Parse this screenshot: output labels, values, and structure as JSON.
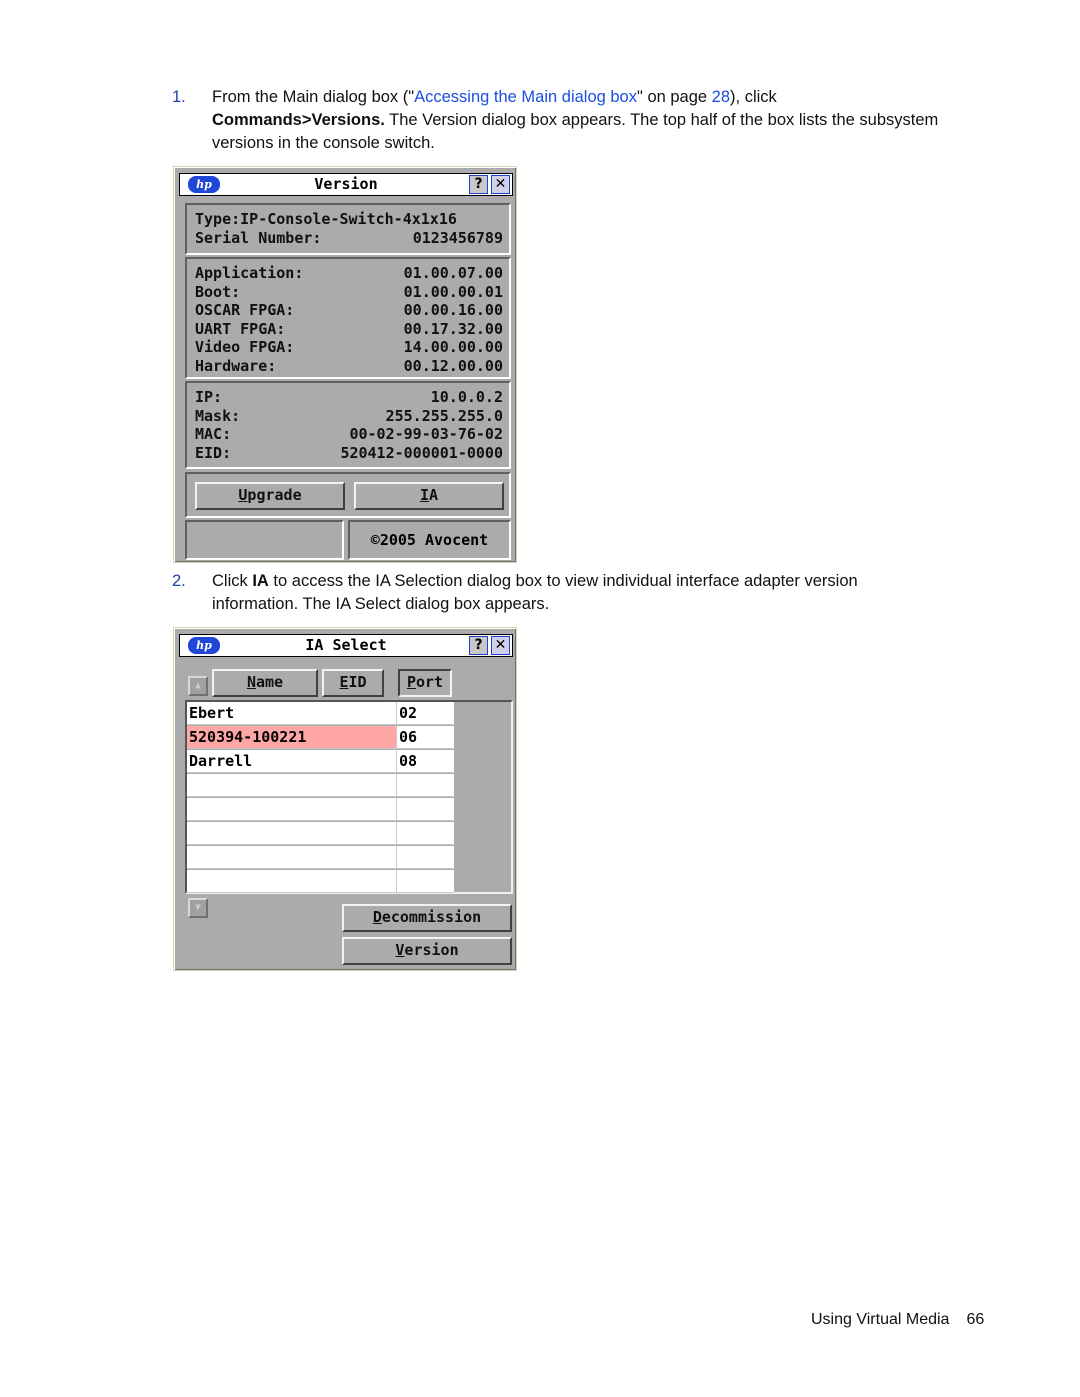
{
  "steps": [
    {
      "number": "1.",
      "text_before_link": "From the Main dialog box (\"",
      "link_text": "Accessing the Main dialog box",
      "text_mid": "\" on page ",
      "page_link": "28",
      "text_after": "), click",
      "bold": "Commands>Versions.",
      "text_rest": " The Version dialog box appears. The top half of the box lists the subsystem versions in the console switch."
    },
    {
      "number": "2.",
      "text_before_bold": "Click ",
      "bold": "IA",
      "text_rest": " to access the IA Selection dialog box to view individual interface adapter version information. The IA Select dialog box appears."
    }
  ],
  "version_dialog": {
    "logo": "hp",
    "title": "Version",
    "help_icon": "?",
    "close_icon": "✕",
    "identity": [
      {
        "label": "Type:IP-Console-Switch-4x1x16",
        "value": ""
      },
      {
        "label": "Serial Number:",
        "value": "0123456789"
      }
    ],
    "versions": [
      {
        "label": "Application:",
        "value": "01.00.07.00"
      },
      {
        "label": "Boot:",
        "value": "01.00.00.01"
      },
      {
        "label": "OSCAR FPGA:",
        "value": "00.00.16.00"
      },
      {
        "label": "UART FPGA:",
        "value": "00.17.32.00"
      },
      {
        "label": "Video FPGA:",
        "value": "14.00.00.00"
      },
      {
        "label": "Hardware:",
        "value": "00.12.00.00"
      }
    ],
    "network": [
      {
        "label": "IP:",
        "value": "10.0.0.2"
      },
      {
        "label": "Mask:",
        "value": "255.255.255.0"
      },
      {
        "label": "MAC:",
        "value": "00-02-99-03-76-02"
      },
      {
        "label": "EID:",
        "value": "520412-000001-0000"
      }
    ],
    "buttons": {
      "upgrade_hotkey": "U",
      "upgrade_rest": "pgrade",
      "ia_hotkey": "I",
      "ia_rest": "A"
    },
    "copyright": "©2005 Avocent"
  },
  "ia_select_dialog": {
    "logo": "hp",
    "title": "IA Select",
    "help_icon": "?",
    "close_icon": "✕",
    "sort_buttons": {
      "name_hotkey": "N",
      "name_rest": "ame",
      "eid_hotkey": "E",
      "eid_rest": "ID",
      "port_hotkey": "P",
      "port_rest": "ort"
    },
    "rows": [
      {
        "name": "Ebert",
        "port": "02",
        "selected": false
      },
      {
        "name": "520394-100221",
        "port": "06",
        "selected": true
      },
      {
        "name": "Darrell",
        "port": "08",
        "selected": false
      },
      {
        "name": "",
        "port": "",
        "selected": false
      },
      {
        "name": "",
        "port": "",
        "selected": false
      },
      {
        "name": "",
        "port": "",
        "selected": false
      },
      {
        "name": "",
        "port": "",
        "selected": false
      },
      {
        "name": "",
        "port": "",
        "selected": false
      }
    ],
    "buttons": {
      "decommission_hotkey": "D",
      "decommission_rest": "ecommission",
      "version_hotkey": "V",
      "version_rest": "ersion"
    },
    "selected_row_color": "#ffa6a6"
  },
  "footer": {
    "section": "Using Virtual Media",
    "page": "66"
  }
}
